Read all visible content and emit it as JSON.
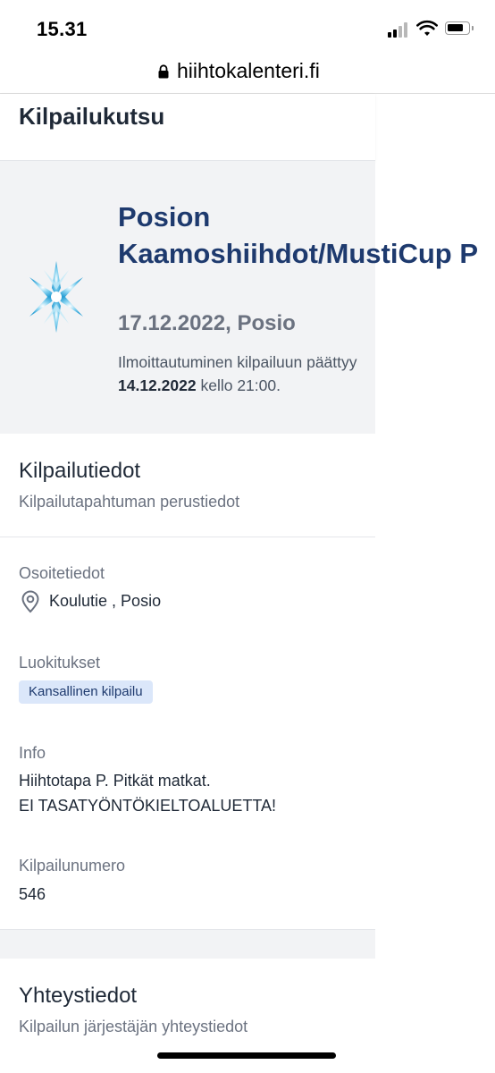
{
  "status_bar": {
    "time": "15.31"
  },
  "browser": {
    "url": "hiihtokalenteri.fi"
  },
  "page": {
    "title": "Kilpailukutsu"
  },
  "event": {
    "title": "Posion Kaamoshiihdot/MustiCup P",
    "date_location": "17.12.2022, Posio",
    "registration_prefix": "Ilmoittautuminen kilpailuun päättyy",
    "registration_deadline": "14.12.2022",
    "registration_suffix": "kello 21:00."
  },
  "competition_info": {
    "title": "Kilpailutiedot",
    "subtitle": "Kilpailutapahtuman perustiedot",
    "address_label": "Osoitetiedot",
    "address_value": "Koulutie , Posio",
    "classification_label": "Luokitukset",
    "classification_badge": "Kansallinen kilpailu",
    "info_label": "Info",
    "info_line1": "Hiihtotapa P. Pitkät matkat.",
    "info_line2": "EI TASATYÖNTÖKIELTOALUETTA!",
    "number_label": "Kilpailunumero",
    "number_value": "546"
  },
  "contact": {
    "title": "Yhteystiedot",
    "subtitle": "Kilpailun järjestäjän yhteystiedot"
  },
  "colors": {
    "accent": "#1e3a6e",
    "badge_bg": "#dbe7fa",
    "page_bg": "#f2f3f5"
  }
}
